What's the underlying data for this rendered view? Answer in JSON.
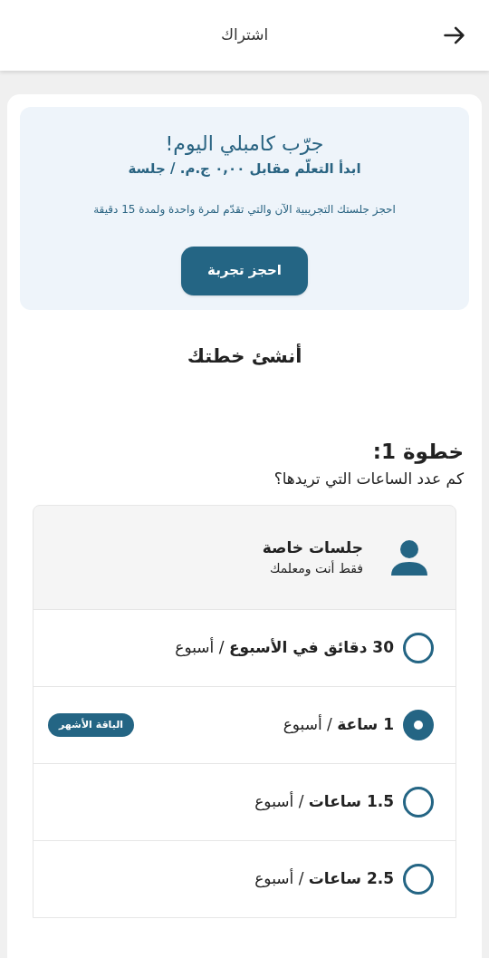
{
  "header": {
    "title": "اشتراك"
  },
  "trial": {
    "title": "جرّب كامبلي اليوم!",
    "subtitle": "ابدأ التعلّم مقابل ٠,٠٠ ج.م. / جلسة",
    "description": "احجز جلستك التجريبية الآن والتي تقدّم لمرة واحدة ولمدة 15 دقيقة",
    "button": "احجز تجربة"
  },
  "plan": {
    "heading": "أنشئ خطتك",
    "step": "خطوة 1:",
    "question": "كم عدد الساعات التي تريدها؟"
  },
  "session_type": {
    "title": "جلسات خاصة",
    "subtitle": "فقط أنت ومعلمك"
  },
  "options": [
    {
      "label": "**30 دقائق في الأسبوع** / أسبوع",
      "selected": false
    },
    {
      "label": "**1 ساعة** / أسبوع",
      "selected": true,
      "badge": "الباقة الأشهر"
    },
    {
      "label": "**1.5 ساعات** / أسبوع",
      "selected": false
    },
    {
      "label": "**2.5 ساعات** / أسبوع",
      "selected": false
    }
  ]
}
